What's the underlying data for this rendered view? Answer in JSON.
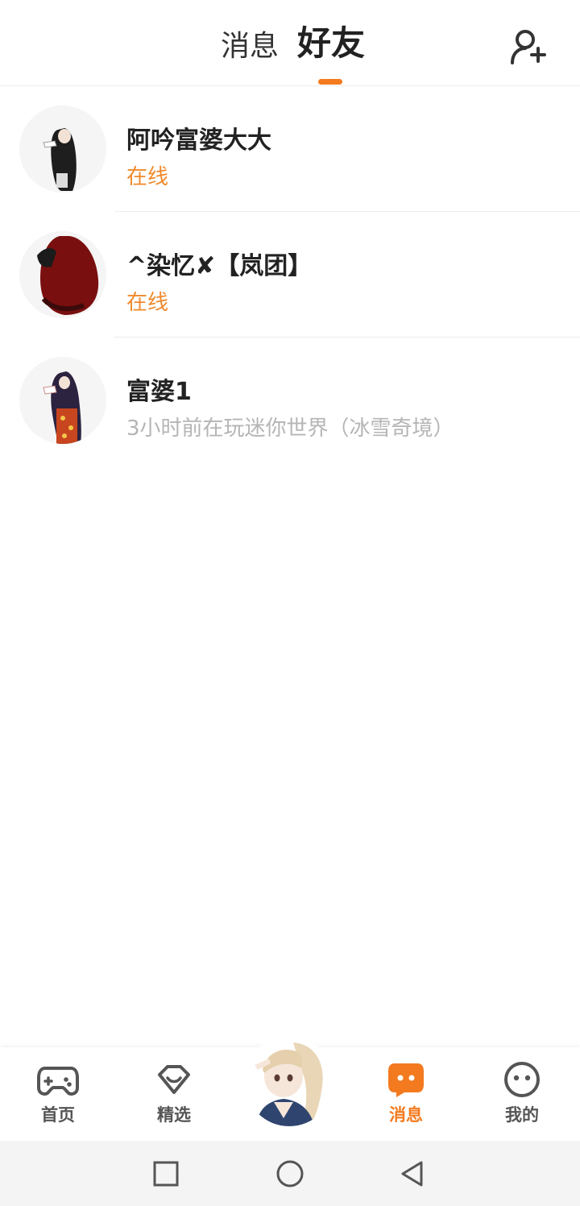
{
  "header": {
    "tab_messages": "消息",
    "tab_friends": "好友",
    "active_tab": "好友",
    "add_friend_icon": "add-user-icon",
    "accent_color": "#f47a1f"
  },
  "friends": [
    {
      "name": "阿吟富婆大大",
      "status": "在线",
      "online": true
    },
    {
      "name": "^染忆✘【岚团】",
      "status": "在线",
      "online": true
    },
    {
      "name": "富婆1",
      "status": "3小时前在玩迷你世界（冰雪奇境）",
      "online": false
    }
  ],
  "nav": {
    "items": [
      {
        "label": "首页",
        "icon": "gamepad-icon"
      },
      {
        "label": "精选",
        "icon": "heart-bubble-icon"
      },
      {
        "label": "消息",
        "icon": "chat-bubble-icon",
        "active": true
      },
      {
        "label": "我的",
        "icon": "smiley-face-icon"
      }
    ]
  },
  "system_bar": {
    "buttons": [
      "recent-apps-icon",
      "home-icon",
      "back-icon"
    ]
  }
}
